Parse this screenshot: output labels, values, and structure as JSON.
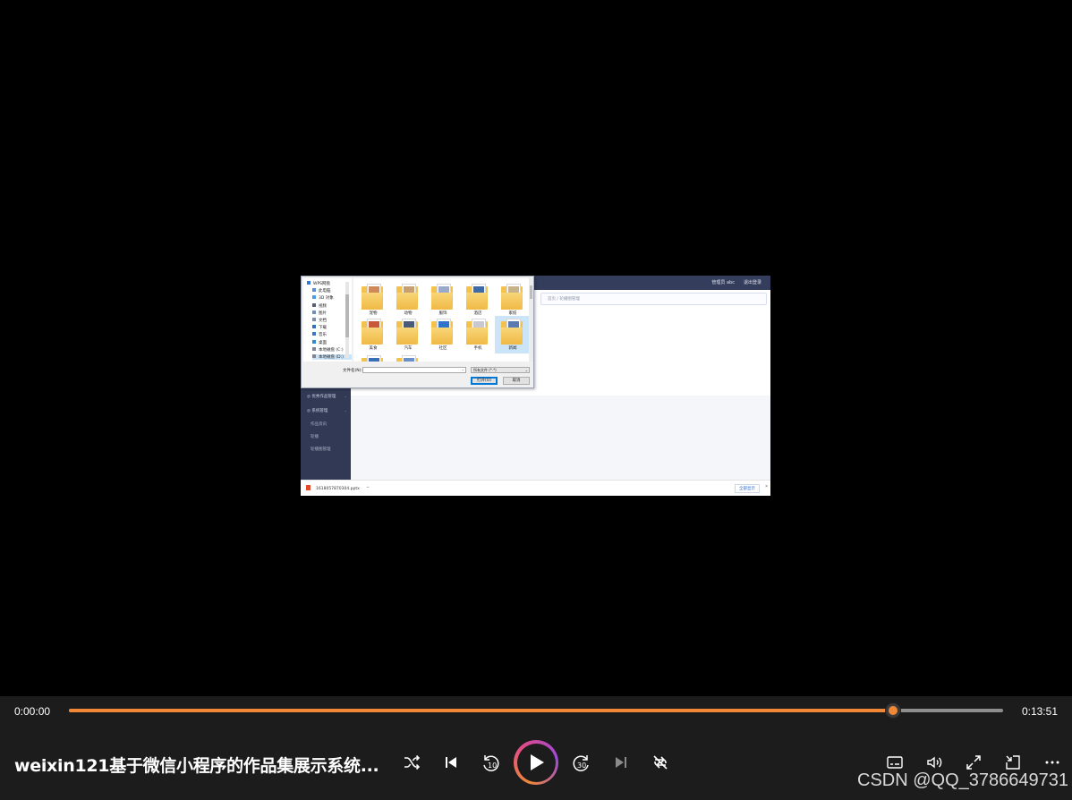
{
  "window": {
    "embedded_app": {
      "topbar_right": [
        "管理员 abc",
        "退出登录"
      ],
      "breadcrumb": "首页 / 轮播图管理",
      "sidebar": [
        {
          "label": "优秀作品管理",
          "sub": false,
          "chevron": true
        },
        {
          "label": "系统管理",
          "sub": false,
          "chevron": true
        },
        {
          "label": "作品资讯",
          "sub": true,
          "chevron": false
        },
        {
          "label": "轮播",
          "sub": true,
          "chevron": false
        },
        {
          "label": "轮播图管理",
          "sub": true,
          "chevron": false
        }
      ],
      "download": {
        "file": "1618057870304.pptx",
        "show_all": "全部显示",
        "close": "×",
        "chevron": "^"
      }
    },
    "file_dialog": {
      "nav": [
        {
          "label": "WPS网盘",
          "color": "#2f7ad6",
          "selected": false
        },
        {
          "label": "此电脑",
          "color": "#5a8fd6",
          "selected": false
        },
        {
          "label": "3D 对象",
          "color": "#4c9be8",
          "selected": false
        },
        {
          "label": "视频",
          "color": "#555f75",
          "selected": false
        },
        {
          "label": "图片",
          "color": "#6a8fc0",
          "selected": false
        },
        {
          "label": "文档",
          "color": "#7a8ea8",
          "selected": false
        },
        {
          "label": "下载",
          "color": "#2f6fc4",
          "selected": false
        },
        {
          "label": "音乐",
          "color": "#3a78d0",
          "selected": false
        },
        {
          "label": "桌面",
          "color": "#2f8bd0",
          "selected": false
        },
        {
          "label": "本地磁盘 (C:)",
          "color": "#7d8796",
          "selected": false
        },
        {
          "label": "本地磁盘 (D:)",
          "color": "#7d8796",
          "selected": true
        }
      ],
      "folders": [
        {
          "label": "宠物",
          "img": "#d08a5a"
        },
        {
          "label": "动物",
          "img": "#c8a070"
        },
        {
          "label": "服饰",
          "img": "#9aa9c9"
        },
        {
          "label": "酒店",
          "img": "#3f6aa8"
        },
        {
          "label": "家纺",
          "img": "#c7b28a"
        },
        {
          "label": "美食",
          "img": "#c85a3a"
        },
        {
          "label": "汽车",
          "img": "#4a5a78"
        },
        {
          "label": "社区",
          "img": "#2f74c8"
        },
        {
          "label": "手机",
          "img": "#c8c8d0"
        },
        {
          "label": "新闻",
          "img": "#5a7ab0"
        },
        {
          "label": "",
          "img": "#3a6fb8"
        },
        {
          "label": "",
          "img": "#6a90c8"
        }
      ],
      "selected_folder": 9,
      "filename_label": "文件名(N):",
      "filename_value": "",
      "filetype": "所有文件 (*.*)",
      "open_button": "打开(O)",
      "cancel_button": "取消"
    }
  },
  "player": {
    "current_time": "0:00:00",
    "total_time": "0:13:51",
    "progress": 0.882,
    "title": "weixin121基于微信小程序的作品集展示系统...",
    "accent_color": "#f08838",
    "icons": [
      "shuffle-icon",
      "previous-icon",
      "rewind-10-icon",
      "play-icon",
      "forward-30-icon",
      "next-icon",
      "repeat-off-icon",
      "subtitles-icon",
      "volume-icon",
      "fullscreen-icon",
      "mini-player-icon",
      "more-icon"
    ]
  },
  "watermark": "CSDN @QQ_3786649731"
}
